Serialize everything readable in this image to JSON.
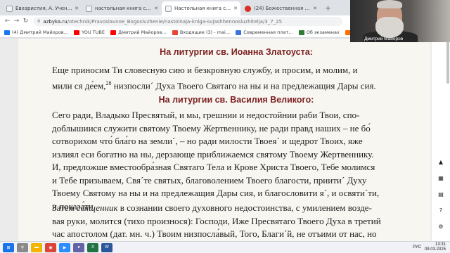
{
  "tabs": [
    {
      "title": "Евхаристия, А. Учение Церкв…",
      "icon": "book-icon",
      "active": false
    },
    {
      "title": "настольная книга священно…",
      "icon": "book-icon",
      "active": false
    },
    {
      "title": "Настольная книга священн…",
      "icon": "book-icon",
      "active": true
    },
    {
      "title": "(24) Божественная Литургия. Л…",
      "icon": "youtube-icon",
      "active": false
    }
  ],
  "address": {
    "host": "azbyka.ru",
    "path": "/otechnik/Pravoslavnoe_Bogosluzhenie/nastolnaja-kniga-svjashhennosluzhitelja/3_7_25"
  },
  "bookmarks": [
    {
      "label": "(4) Дмитрий Майоров…",
      "icon": "facebook-icon",
      "color": "#1877f2"
    },
    {
      "label": "YOU TUBE",
      "icon": "youtube-icon",
      "color": "#ff0000"
    },
    {
      "label": "Дмитрий Майоров…",
      "icon": "youtube-icon",
      "color": "#ff0000"
    },
    {
      "label": "Входящие (3) - mai…",
      "icon": "mail-icon",
      "color": "#ea4335"
    },
    {
      "label": "Современная плат…",
      "icon": "bookmark-icon",
      "color": "#3b73d9"
    },
    {
      "label": "Об экзаменах",
      "icon": "bookmark-icon",
      "color": "#2e7d32"
    },
    {
      "label": "Дмитрий Майоров…",
      "icon": "bookmark-icon",
      "color": "#ff6f00"
    }
  ],
  "camera": {
    "name": "Дмитрий Майоров"
  },
  "doc": {
    "heading1": "На литургии св. Иоанна Златоуста:",
    "para1_lines": [
      "Еще приносим Ти словесную сию и безкровную службу, и просим, и молим, и",
      "мили ся де́ем,|28| низпосли´ Духа Твоего Святаго на ны и на предлежащия Дары сия."
    ],
    "heading2": "На литургии св. Василия Великого:",
    "para2_lines": [
      "Сего ради, Владыко Пресвятый, и мы, грешнии и недостойнии раби Твои, спо-",
      "доблышиися служити святому Твоему Жертвеннику, не ради правд наших – не бо́",
      "сотворихом что́ бла́го на земли´, – но ради милости Твоея´ и щедрот Твоих, яже",
      "излиял еси богатно на ны, дерзающе приближаемся святому Твоему Жертвеннику.",
      "И, предложше вместообра́зная Святаго Тела и Крове Христа Твоего, Тебе молимся",
      "и Тебе призываем, Свя´те святых, благоволением Твоего благости, приити´ Духу",
      "Твоему Святому на ны и на предлежащия Дары сия, и благословити я´, и освяти´ти,",
      "и показа́ти."
    ],
    "para3_lines": [
      "Затем |священник| в сознании своего духовного недостоинства, с умилением возде-",
      "вая руки, молится (тихо произнося): Господи, Иже Пресвятаго Твоего Духа в третий",
      "час апостолом (дат. мн. ч.) Твоим низпосла́вый, Того, Благи´й, не отъими от нас, но"
    ]
  },
  "taskbar": {
    "lang": "РУС",
    "time": "13:31",
    "date": "09.03.2025"
  },
  "colors": {
    "heading": "#7a1f1f",
    "page_bg": "#f8f6f1",
    "text": "#1f1f1f"
  }
}
